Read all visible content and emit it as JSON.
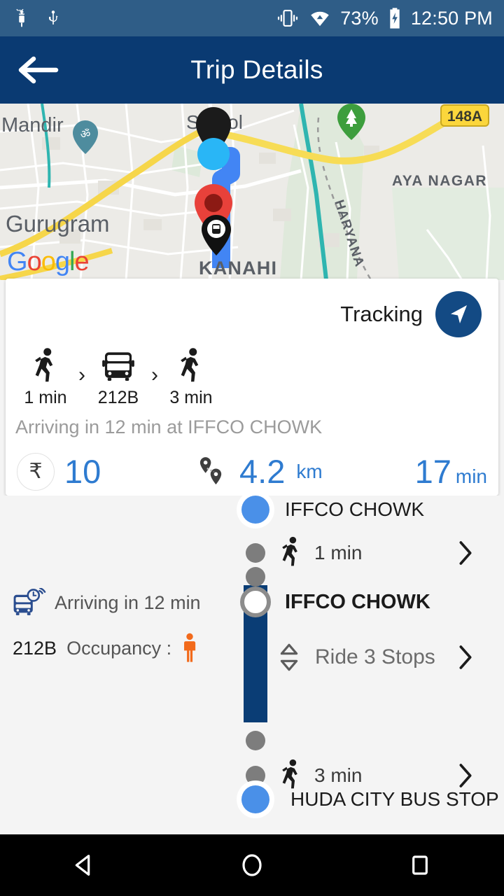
{
  "statusbar": {
    "left_icons": [
      "android-debug-icon",
      "usb-icon"
    ],
    "right_icons": [
      "vibrate-icon",
      "wifi-icon",
      "battery-charging-icon"
    ],
    "battery_percent": "73%",
    "time": "12:50 PM"
  },
  "header": {
    "title": "Trip Details",
    "back_icon": "back-arrow-icon",
    "bg_color": "#0a3a72"
  },
  "map": {
    "labels": {
      "mandir": "Mandir",
      "sarhol": "Sarhol",
      "aya_nagar": "AYA NAGAR",
      "gurugram": "Gurugram",
      "kanahi": "KANAHI",
      "haryana": "HARYANA",
      "highway_shield": "148A"
    },
    "attribution": {
      "g1": "G",
      "o1": "o",
      "o2": "o",
      "g2": "g",
      "l": "l",
      "e": "e"
    },
    "markers": [
      "current-location-marker",
      "destination-pin-marker",
      "bus-marker",
      "temple-poi-marker",
      "park-poi-marker"
    ]
  },
  "card": {
    "tracking_label": "Tracking",
    "nav_icon": "navigation-arrow-icon",
    "accent_color": "#134a84",
    "legs": [
      {
        "icon": "walk-icon",
        "label": "1 min"
      },
      {
        "icon": "bus-icon",
        "label": "212B"
      },
      {
        "icon": "walk-icon",
        "label": "3 min"
      }
    ],
    "separator": "›",
    "arriving_text": "Arriving in 12 min at IFFCO CHOWK",
    "summary": {
      "currency_symbol": "₹",
      "fare": "10",
      "distance_value": "4.2",
      "distance_unit": "km",
      "duration_value": "17",
      "duration_unit": "min",
      "value_color": "#2e7bd0"
    }
  },
  "bus_info": {
    "eta_icon": "bus-alert-icon",
    "eta_text": "Arriving in 12 min",
    "route_number": "212B",
    "occupancy_label": "Occupancy :",
    "occupancy_icon": "person-occupancy-icon",
    "occupancy_color": "#f26a1b"
  },
  "timeline": {
    "steps": [
      {
        "type": "stop",
        "dot": "blue",
        "label": "IFFCO CHOWK",
        "bold": false,
        "chevron": false
      },
      {
        "type": "walk",
        "dot": "gray",
        "icon": "walk-icon",
        "label": "1 min",
        "chevron": true
      },
      {
        "type": "spacer",
        "dot": "gray",
        "label": "",
        "chevron": false
      },
      {
        "type": "board",
        "dot": "ring",
        "label": "IFFCO CHOWK",
        "bold": true,
        "chevron": false
      },
      {
        "type": "ride",
        "icon": "expand-vertical-icon",
        "label": "Ride 3 Stops",
        "chevron": true
      },
      {
        "type": "spacer",
        "dot": "gray",
        "label": "",
        "chevron": false
      },
      {
        "type": "walk",
        "dot": "gray",
        "icon": "walk-icon",
        "label": "3 min",
        "chevron": true
      },
      {
        "type": "stop",
        "dot": "blue",
        "label": "HUDA CITY BUS STOP",
        "bold": false,
        "chevron": false
      }
    ],
    "bar_color": "#0a3d75"
  },
  "navbar": {
    "back": "nav-back-icon",
    "home": "nav-home-icon",
    "recents": "nav-recents-icon"
  }
}
